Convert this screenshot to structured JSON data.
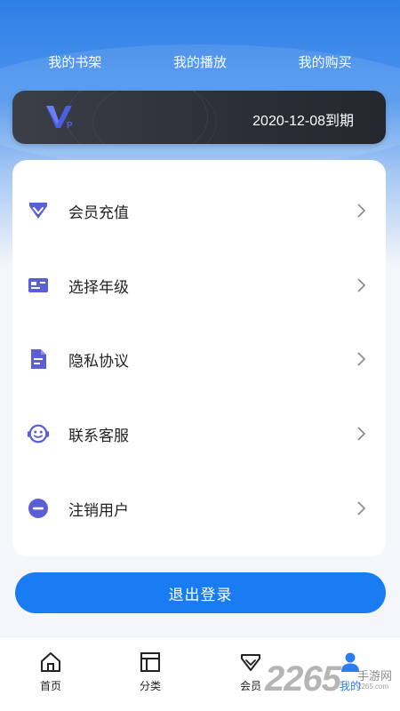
{
  "top_links": [
    "我的书架",
    "我的播放",
    "我的购买"
  ],
  "vip": {
    "logo_text": "V",
    "logo_sub": "P",
    "expiry": "2020-12-08到期"
  },
  "menu": [
    {
      "label": "会员充值",
      "icon": "diamond-icon"
    },
    {
      "label": "选择年级",
      "icon": "id-card-icon"
    },
    {
      "label": "隐私协议",
      "icon": "document-icon"
    },
    {
      "label": "联系客服",
      "icon": "customer-service-icon"
    },
    {
      "label": "注销用户",
      "icon": "minus-circle-icon"
    }
  ],
  "logout_label": "退出登录",
  "tabs": [
    {
      "label": "首页",
      "icon": "home-icon"
    },
    {
      "label": "分类",
      "icon": "category-icon"
    },
    {
      "label": "会员",
      "icon": "diamond-icon"
    },
    {
      "label": "我的",
      "icon": "user-icon",
      "active": true
    }
  ],
  "watermark": {
    "number": "2265",
    "text": "手游网",
    "sub": "2265.com"
  },
  "colors": {
    "accent": "#1a7cf3",
    "icon_purple": "#5b5fd6",
    "header_blue": "#2e7fe6",
    "vip_card": "#2c3038"
  }
}
